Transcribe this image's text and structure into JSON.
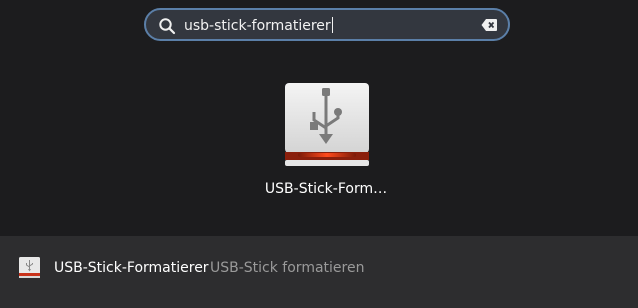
{
  "search": {
    "value": "usb-stick-formatierer",
    "icon": "search-icon",
    "clear_icon": "clear-text-icon"
  },
  "app_grid": {
    "items": [
      {
        "label": "USB-Stick-Form…",
        "icon": "usb-drive-icon"
      }
    ]
  },
  "results": {
    "items": [
      {
        "title": "USB-Stick-Formatierer",
        "description": "USB-Stick formatieren",
        "icon": "usb-drive-icon"
      }
    ]
  },
  "colors": {
    "background": "#1c1c1e",
    "search_border": "#5b7fa8",
    "results_background": "#2d2d2f",
    "accent_red": "#e03a1e"
  }
}
